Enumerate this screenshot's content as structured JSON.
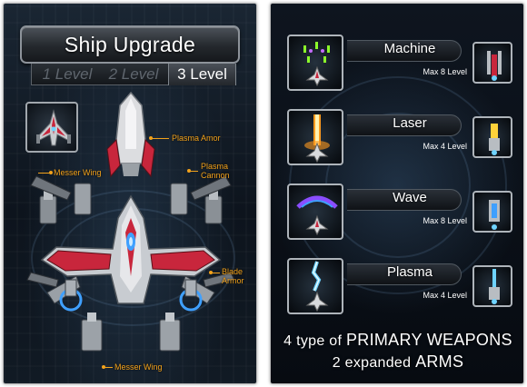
{
  "colors": {
    "callout": "#f2a21b",
    "hull_red": "#c8263c",
    "hull_white": "#e4e4e4",
    "engine_blue": "#3fa0ff",
    "laser_orange": "#ff9a1e",
    "wave_purple": "#8a4dff",
    "plasma_blue": "#6fd3ff",
    "machine_green": "#8cff2a"
  },
  "left": {
    "title": "Ship Upgrade",
    "levels": [
      "1 Level",
      "2 Level",
      "3 Level"
    ],
    "active_level": 2,
    "parts": {
      "plasma_armor": "Plasma Amor",
      "messer_wing_top": "Messer Wing",
      "plasma_cannon_line1": "Plasma",
      "plasma_cannon_line2": "Cannon",
      "blade_armor_line1": "Blade",
      "blade_armor_line2": "Armor",
      "messer_wing_bottom": "Messer Wing"
    }
  },
  "right": {
    "weapons": [
      {
        "name": "Machine",
        "max": "Max 8 Level",
        "effect": "machine"
      },
      {
        "name": "Laser",
        "max": "Max 4 Level",
        "effect": "laser"
      },
      {
        "name": "Wave",
        "max": "Max 8 Level",
        "effect": "wave"
      },
      {
        "name": "Plasma",
        "max": "Max 4 Level",
        "effect": "plasma"
      }
    ],
    "footer": {
      "line1_pre": "4 type of",
      "line1_hl": "PRIMARY WEAPONS",
      "line2_pre": "2 expanded",
      "line2_hl": "ARMS"
    }
  }
}
